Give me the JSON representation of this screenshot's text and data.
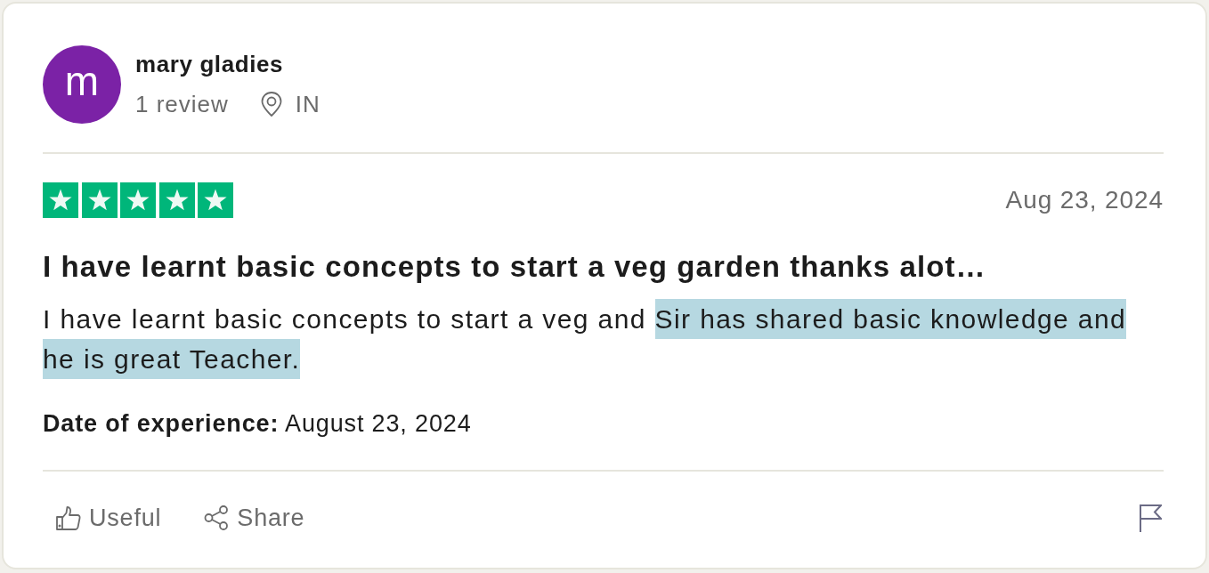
{
  "reviewer": {
    "initial": "m",
    "name": "mary gladies",
    "review_count": "1 review",
    "country": "IN"
  },
  "review": {
    "stars": 5,
    "date": "Aug 23, 2024",
    "title": "I have learnt basic concepts to start a veg garden thanks alot…",
    "body": [
      {
        "text": "I have learnt basic concepts to start a veg and ",
        "highlighted": false
      },
      {
        "text": "Sir has shared basic knowledge and he is great Teacher.",
        "highlighted": true
      }
    ],
    "experience": "**Date of experience:** August 23, 2024"
  },
  "actions": [
    {
      "kind": "useful",
      "label": "Useful"
    },
    {
      "kind": "share",
      "label": "Share"
    },
    {
      "kind": "report"
    }
  ]
}
